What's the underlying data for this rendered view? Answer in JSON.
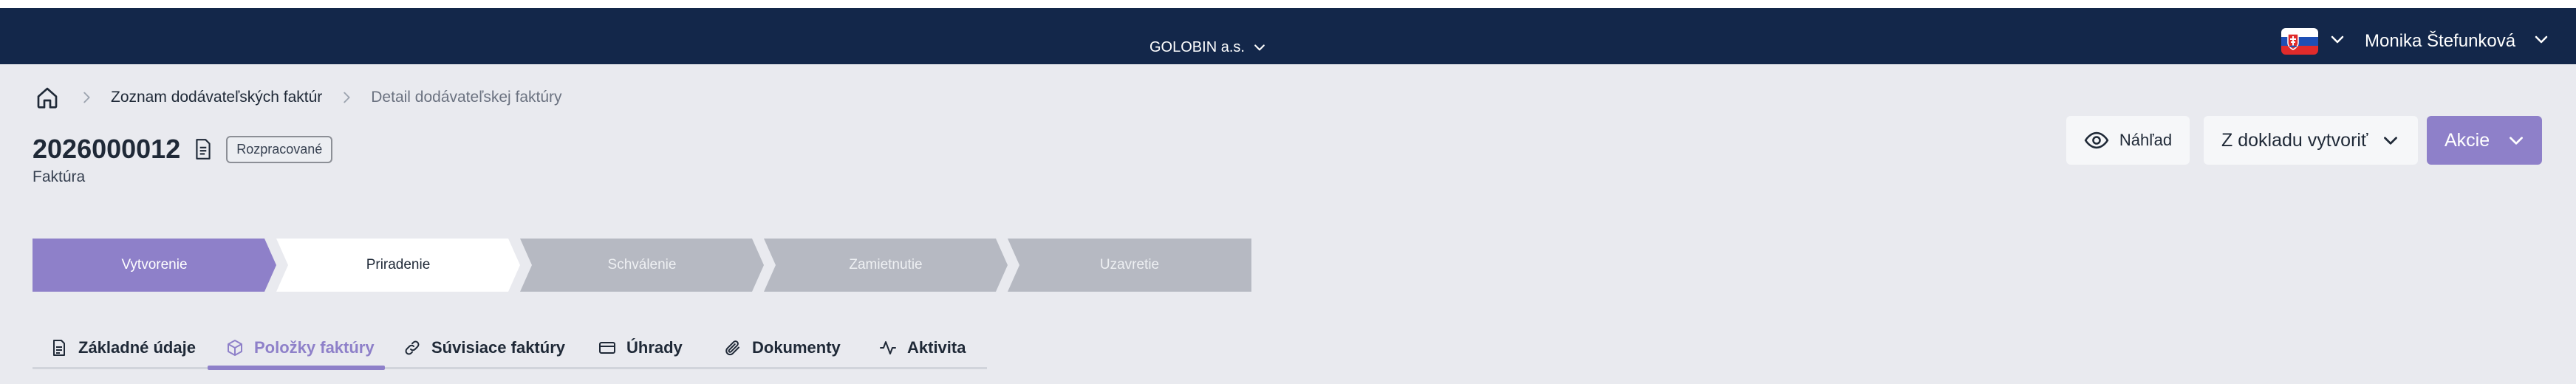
{
  "header": {
    "company": "GOLOBIN a.s.",
    "flag_icon": "slovakia-flag-icon",
    "user_name": "Monika Štefunková"
  },
  "breadcrumb": {
    "home_icon": "home-icon",
    "items": [
      "Zoznam dodávateľských faktúr",
      "Detail dodávateľskej faktúry"
    ]
  },
  "document": {
    "number": "2026000012",
    "status": "Rozpracované",
    "type": "Faktúra"
  },
  "actions": {
    "preview_label": "Náhľad",
    "create_from_label": "Z dokladu vytvoriť",
    "actions_label": "Akcie"
  },
  "workflow": {
    "steps": [
      "Vytvorenie",
      "Priradenie",
      "Schválenie",
      "Zamietnutie",
      "Uzavretie"
    ],
    "states": [
      "done",
      "current",
      "pending",
      "pending",
      "pending"
    ],
    "colors": {
      "done": "#8e80c9",
      "current": "#ffffff",
      "pending": "#b6b9c2"
    }
  },
  "tabs": {
    "items": [
      {
        "label": "Základné údaje",
        "icon": "document-icon"
      },
      {
        "label": "Položky faktúry",
        "icon": "box-icon"
      },
      {
        "label": "Súvisiace faktúry",
        "icon": "link-icon"
      },
      {
        "label": "Úhrady",
        "icon": "credit-card-icon"
      },
      {
        "label": "Dokumenty",
        "icon": "paperclip-icon"
      },
      {
        "label": "Aktivita",
        "icon": "activity-icon"
      }
    ],
    "active_index": 1
  },
  "colors": {
    "navbar": "#13274a",
    "accent": "#8e80c9",
    "background": "#e9eaef"
  }
}
